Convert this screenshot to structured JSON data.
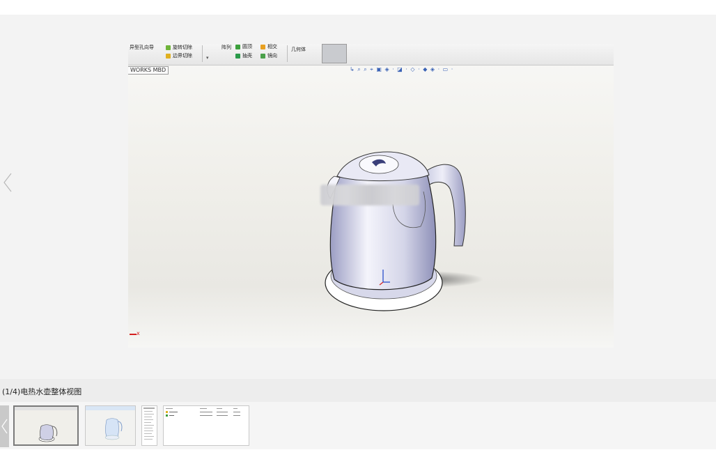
{
  "viewer": {
    "prev_label": "previous image",
    "screenshot": {
      "ribbon": {
        "items": [
          "异型孔向导",
          "旋转切除",
          "放样切割",
          "边界切除",
          "阵列",
          "圆顶",
          "抽壳",
          "相交",
          "镜向",
          "几何体"
        ]
      },
      "mbd_tab": "WORKS MBD",
      "view_tools": "↳ ⌕ ⌕ ⌖ ▣ ◈ · ◪ · ◇ · ◆ ◈ · ▭ ·",
      "axis_label": "x"
    }
  },
  "caption": {
    "text": "(1/4)电热水壶整体视图"
  },
  "thumbnails": {
    "prev_label": "previous thumbnails",
    "items": [
      {
        "name": "kettle overall view",
        "active": true
      },
      {
        "name": "kettle render",
        "active": false
      },
      {
        "name": "feature tree",
        "active": false
      },
      {
        "name": "file list",
        "active": false
      }
    ]
  },
  "colors": {
    "viewer_bg": "#f3f3f3",
    "caption_bg": "#ededed",
    "kettle_body": "#dcdcec",
    "kettle_shade": "#8e90b8",
    "axis_red": "#d42020"
  }
}
